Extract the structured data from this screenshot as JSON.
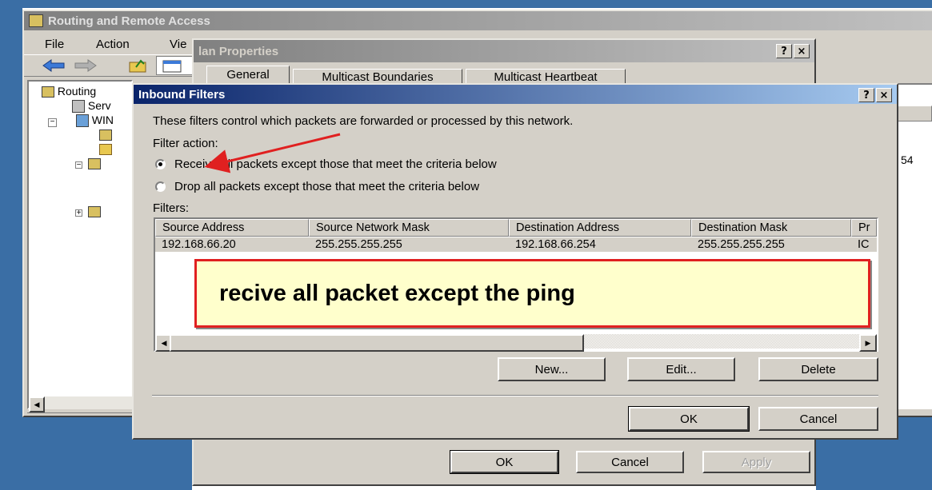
{
  "mmc": {
    "title": "Routing and Remote Access",
    "menus": [
      "File",
      "Action",
      "Vie"
    ],
    "tree": {
      "root": "Routing",
      "item1": "Serv",
      "item2": "WIN"
    },
    "right_value": "54"
  },
  "props": {
    "title": "lan Properties",
    "tabs": [
      "General",
      "Multicast Boundaries",
      "Multicast Heartbeat"
    ],
    "buttons": {
      "ok": "OK",
      "cancel": "Cancel",
      "apply": "Apply"
    }
  },
  "filters": {
    "title": "Inbound Filters",
    "description": "These filters control which packets are forwarded or processed by this network.",
    "filter_action_label": "Filter action:",
    "radio_receive": "Receive all packets except those that meet the criteria below",
    "radio_drop": "Drop all packets except those that meet the criteria below",
    "radio_selected": "receive",
    "filters_label": "Filters:",
    "columns": [
      "Source Address",
      "Source Network Mask",
      "Destination Address",
      "Destination Mask",
      "Pr"
    ],
    "rows": [
      [
        "192.168.66.20",
        "255.255.255.255",
        "192.168.66.254",
        "255.255.255.255",
        "IC"
      ]
    ],
    "buttons": {
      "new": "New...",
      "edit": "Edit...",
      "delete": "Delete",
      "ok": "OK",
      "cancel": "Cancel"
    }
  },
  "annotation": {
    "callout_text": "recive all packet except the ping",
    "arrow_color": "#e02020"
  },
  "title_buttons": {
    "help": "?",
    "close": "×"
  }
}
